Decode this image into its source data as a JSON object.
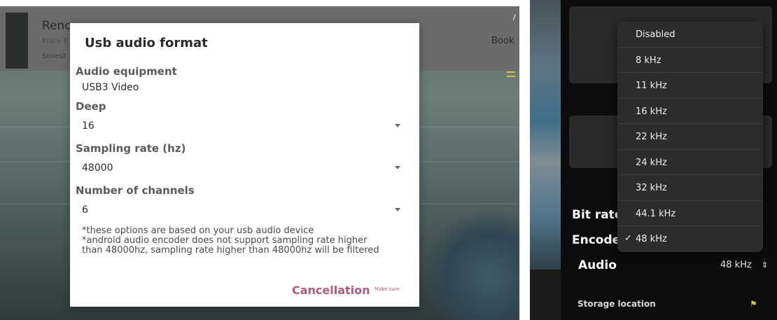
{
  "left": {
    "ad": {
      "title": "Reno",
      "subtitle": "Enjoy E",
      "brand": "Sonest",
      "book": "Book",
      "corner": "/"
    },
    "dialog": {
      "title": "Usb audio format",
      "equipment_label": "Audio equipment",
      "equipment_value": "USB3 Video",
      "deep_label": "Deep",
      "deep_value": "16",
      "sampling_label": "Sampling rate (hz)",
      "sampling_value": "48000",
      "channels_label": "Number of channels",
      "channels_value": "6",
      "note1": "*these options are based on your usb audio device",
      "note2": "*android audio encoder does not support sampling rate higher",
      "note3": "than 48000hz, sampling rate higher than 48000hz will be filtered",
      "cancel_label": "Cancellation",
      "ok_label": "Make sure"
    }
  },
  "right": {
    "bitrate_label": "Bit rate",
    "encoder_label": "Encoder",
    "audio_label": "Audio",
    "audio_value": "48 kHz",
    "storage_label": "Storage location",
    "dropdown_options": [
      "Disabled",
      "8 kHz",
      "11 kHz",
      "16 kHz",
      "22 kHz",
      "24 kHz",
      "32 kHz",
      "44.1 kHz",
      "48 kHz"
    ],
    "selected_option": "48 kHz",
    "check_mark": "✓"
  },
  "colors": {
    "accent": "#b05a7e",
    "dialog_bg": "#ffffff",
    "dark_bg": "#0c0c0c",
    "dropdown_bg": "#2c2c2e"
  }
}
